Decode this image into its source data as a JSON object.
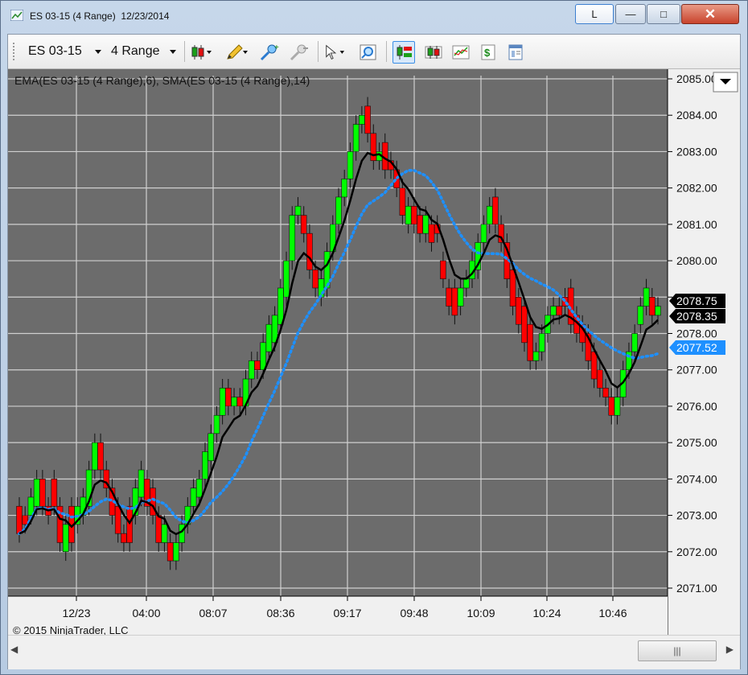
{
  "window": {
    "title": "ES 03-15 (4 Range)  12/23/2014",
    "l_button": "L",
    "minimize": "—",
    "maximize": "□",
    "close": "✕"
  },
  "toolbar": {
    "instrument": "ES 03-15",
    "period": "4 Range",
    "icons": [
      "bar-type-icon",
      "drawing-pencil-icon",
      "zoom-in-icon",
      "zoom-out-icon",
      "pointer-icon",
      "search-icon",
      "chart-trader-icon",
      "candles-icon",
      "indicators-icon",
      "strategies-icon",
      "properties-icon"
    ]
  },
  "chart": {
    "indicator_label": "EMA(ES 03-15 (4 Range),6), SMA(ES 03-15 (4 Range),14)",
    "copyright": "© 2015 NinjaTrader, LLC",
    "y_tick_labels": [
      "2085.00",
      "2084.00",
      "2083.00",
      "2082.00",
      "2081.00",
      "2080.00",
      "2079.00",
      "2078.00",
      "2077.00",
      "2076.00",
      "2075.00",
      "2074.00",
      "2073.00",
      "2072.00",
      "2071.00"
    ],
    "x_tick_labels": [
      "12/23",
      "04:00",
      "08:07",
      "08:36",
      "09:17",
      "09:48",
      "10:09",
      "10:24",
      "10:46"
    ],
    "price_tags": [
      {
        "label": "2078.75",
        "value": 2078.75,
        "color": "#000000"
      },
      {
        "label": "2078.35",
        "value": 2078.35,
        "color": "#000000"
      },
      {
        "label": "2077.52",
        "value": 2077.52,
        "color": "#1e90ff"
      }
    ],
    "colors": {
      "background": "#6c6c6c",
      "up": "#00ff00",
      "down": "#ff0000",
      "ema": "#000000",
      "sma": "#1e90ff",
      "grid": "#dcdcdc"
    }
  },
  "chart_data": {
    "type": "candlestick",
    "ylim": [
      2071.0,
      2085.0
    ],
    "x": [
      "12/23",
      "04:00",
      "08:07",
      "08:36",
      "09:17",
      "09:48",
      "10:09",
      "10:24",
      "10:46"
    ],
    "candles": [
      {
        "o": 2073.25,
        "c": 2072.5
      },
      {
        "o": 2073.0,
        "c": 2072.75
      },
      {
        "o": 2073.0,
        "c": 2073.5
      },
      {
        "o": 2073.25,
        "c": 2074.0
      },
      {
        "o": 2074.0,
        "c": 2073.25
      },
      {
        "o": 2073.25,
        "c": 2073.0
      },
      {
        "o": 2074.0,
        "c": 2073.25
      },
      {
        "o": 2073.25,
        "c": 2072.25
      },
      {
        "o": 2072.0,
        "c": 2072.75
      },
      {
        "o": 2073.25,
        "c": 2072.25
      },
      {
        "o": 2072.75,
        "c": 2073.25
      },
      {
        "o": 2073.0,
        "c": 2073.5
      },
      {
        "o": 2073.25,
        "c": 2074.25
      },
      {
        "o": 2074.25,
        "c": 2075.0
      },
      {
        "o": 2075.0,
        "c": 2074.25
      },
      {
        "o": 2074.25,
        "c": 2073.75
      },
      {
        "o": 2073.75,
        "c": 2073.0
      },
      {
        "o": 2073.25,
        "c": 2072.5
      },
      {
        "o": 2072.5,
        "c": 2072.25
      },
      {
        "o": 2073.25,
        "c": 2072.25
      },
      {
        "o": 2073.0,
        "c": 2073.75
      },
      {
        "o": 2073.5,
        "c": 2074.25
      },
      {
        "o": 2074.0,
        "c": 2073.25
      },
      {
        "o": 2073.75,
        "c": 2073.0
      },
      {
        "o": 2073.0,
        "c": 2072.25
      },
      {
        "o": 2072.25,
        "c": 2072.75
      },
      {
        "o": 2072.25,
        "c": 2071.75
      },
      {
        "o": 2071.75,
        "c": 2072.25
      },
      {
        "o": 2072.25,
        "c": 2072.75
      },
      {
        "o": 2072.75,
        "c": 2073.25
      },
      {
        "o": 2073.25,
        "c": 2073.75
      },
      {
        "o": 2073.5,
        "c": 2074.0
      },
      {
        "o": 2074.0,
        "c": 2074.75
      },
      {
        "o": 2074.5,
        "c": 2075.25
      },
      {
        "o": 2075.25,
        "c": 2075.75
      },
      {
        "o": 2075.75,
        "c": 2076.5
      },
      {
        "o": 2076.5,
        "c": 2076.0
      },
      {
        "o": 2076.0,
        "c": 2076.25
      },
      {
        "o": 2076.25,
        "c": 2076.0
      },
      {
        "o": 2076.0,
        "c": 2076.75
      },
      {
        "o": 2076.75,
        "c": 2077.25
      },
      {
        "o": 2077.25,
        "c": 2077.0
      },
      {
        "o": 2077.0,
        "c": 2077.75
      },
      {
        "o": 2077.5,
        "c": 2078.25
      },
      {
        "o": 2077.75,
        "c": 2078.5
      },
      {
        "o": 2078.25,
        "c": 2079.25
      },
      {
        "o": 2079.0,
        "c": 2080.0
      },
      {
        "o": 2080.0,
        "c": 2081.25
      },
      {
        "o": 2081.25,
        "c": 2081.5
      },
      {
        "o": 2081.25,
        "c": 2080.75
      },
      {
        "o": 2080.75,
        "c": 2079.75
      },
      {
        "o": 2079.75,
        "c": 2079.25
      },
      {
        "o": 2079.0,
        "c": 2079.5
      },
      {
        "o": 2079.25,
        "c": 2080.25
      },
      {
        "o": 2080.25,
        "c": 2081.0
      },
      {
        "o": 2081.0,
        "c": 2081.75
      },
      {
        "o": 2081.75,
        "c": 2082.25
      },
      {
        "o": 2082.25,
        "c": 2083.0
      },
      {
        "o": 2083.0,
        "c": 2083.75
      },
      {
        "o": 2083.75,
        "c": 2084.0
      },
      {
        "o": 2084.25,
        "c": 2083.5
      },
      {
        "o": 2083.5,
        "c": 2082.75
      },
      {
        "o": 2082.75,
        "c": 2083.0
      },
      {
        "o": 2083.25,
        "c": 2082.5
      },
      {
        "o": 2082.75,
        "c": 2082.5
      },
      {
        "o": 2082.5,
        "c": 2082.0
      },
      {
        "o": 2082.0,
        "c": 2081.25
      },
      {
        "o": 2081.0,
        "c": 2081.5
      },
      {
        "o": 2081.5,
        "c": 2081.0
      },
      {
        "o": 2081.25,
        "c": 2080.75
      },
      {
        "o": 2080.75,
        "c": 2081.25
      },
      {
        "o": 2081.0,
        "c": 2080.5
      },
      {
        "o": 2081.0,
        "c": 2080.75
      },
      {
        "o": 2080.0,
        "c": 2079.5
      },
      {
        "o": 2079.25,
        "c": 2078.75
      },
      {
        "o": 2079.25,
        "c": 2078.5
      },
      {
        "o": 2078.75,
        "c": 2079.25
      },
      {
        "o": 2079.25,
        "c": 2079.5
      },
      {
        "o": 2079.5,
        "c": 2080.0
      },
      {
        "o": 2079.75,
        "c": 2080.5
      },
      {
        "o": 2080.5,
        "c": 2081.0
      },
      {
        "o": 2081.0,
        "c": 2081.5
      },
      {
        "o": 2081.75,
        "c": 2081.0
      },
      {
        "o": 2081.0,
        "c": 2080.5
      },
      {
        "o": 2080.5,
        "c": 2079.5
      },
      {
        "o": 2079.75,
        "c": 2078.75
      },
      {
        "o": 2079.0,
        "c": 2078.25
      },
      {
        "o": 2078.75,
        "c": 2077.75
      },
      {
        "o": 2078.25,
        "c": 2077.25
      },
      {
        "o": 2077.25,
        "c": 2077.5
      },
      {
        "o": 2077.5,
        "c": 2078.0
      },
      {
        "o": 2078.0,
        "c": 2078.5
      },
      {
        "o": 2078.5,
        "c": 2078.75
      },
      {
        "o": 2078.75,
        "c": 2078.5
      },
      {
        "o": 2079.0,
        "c": 2078.75
      },
      {
        "o": 2079.25,
        "c": 2078.25
      },
      {
        "o": 2078.5,
        "c": 2078.0
      },
      {
        "o": 2078.25,
        "c": 2077.75
      },
      {
        "o": 2078.0,
        "c": 2077.25
      },
      {
        "o": 2077.5,
        "c": 2076.75
      },
      {
        "o": 2077.0,
        "c": 2076.5
      },
      {
        "o": 2076.5,
        "c": 2076.25
      },
      {
        "o": 2076.25,
        "c": 2075.75
      },
      {
        "o": 2075.75,
        "c": 2076.25
      },
      {
        "o": 2076.25,
        "c": 2077.0
      },
      {
        "o": 2077.0,
        "c": 2077.5
      },
      {
        "o": 2077.5,
        "c": 2078.0
      },
      {
        "o": 2078.25,
        "c": 2078.75
      },
      {
        "o": 2078.75,
        "c": 2079.25
      },
      {
        "o": 2079.0,
        "c": 2078.5
      },
      {
        "o": 2078.5,
        "c": 2078.75
      }
    ],
    "ema_label": "EMA(ES 03-15 (4 Range),6)",
    "sma_label": "SMA(ES 03-15 (4 Range),14)"
  }
}
